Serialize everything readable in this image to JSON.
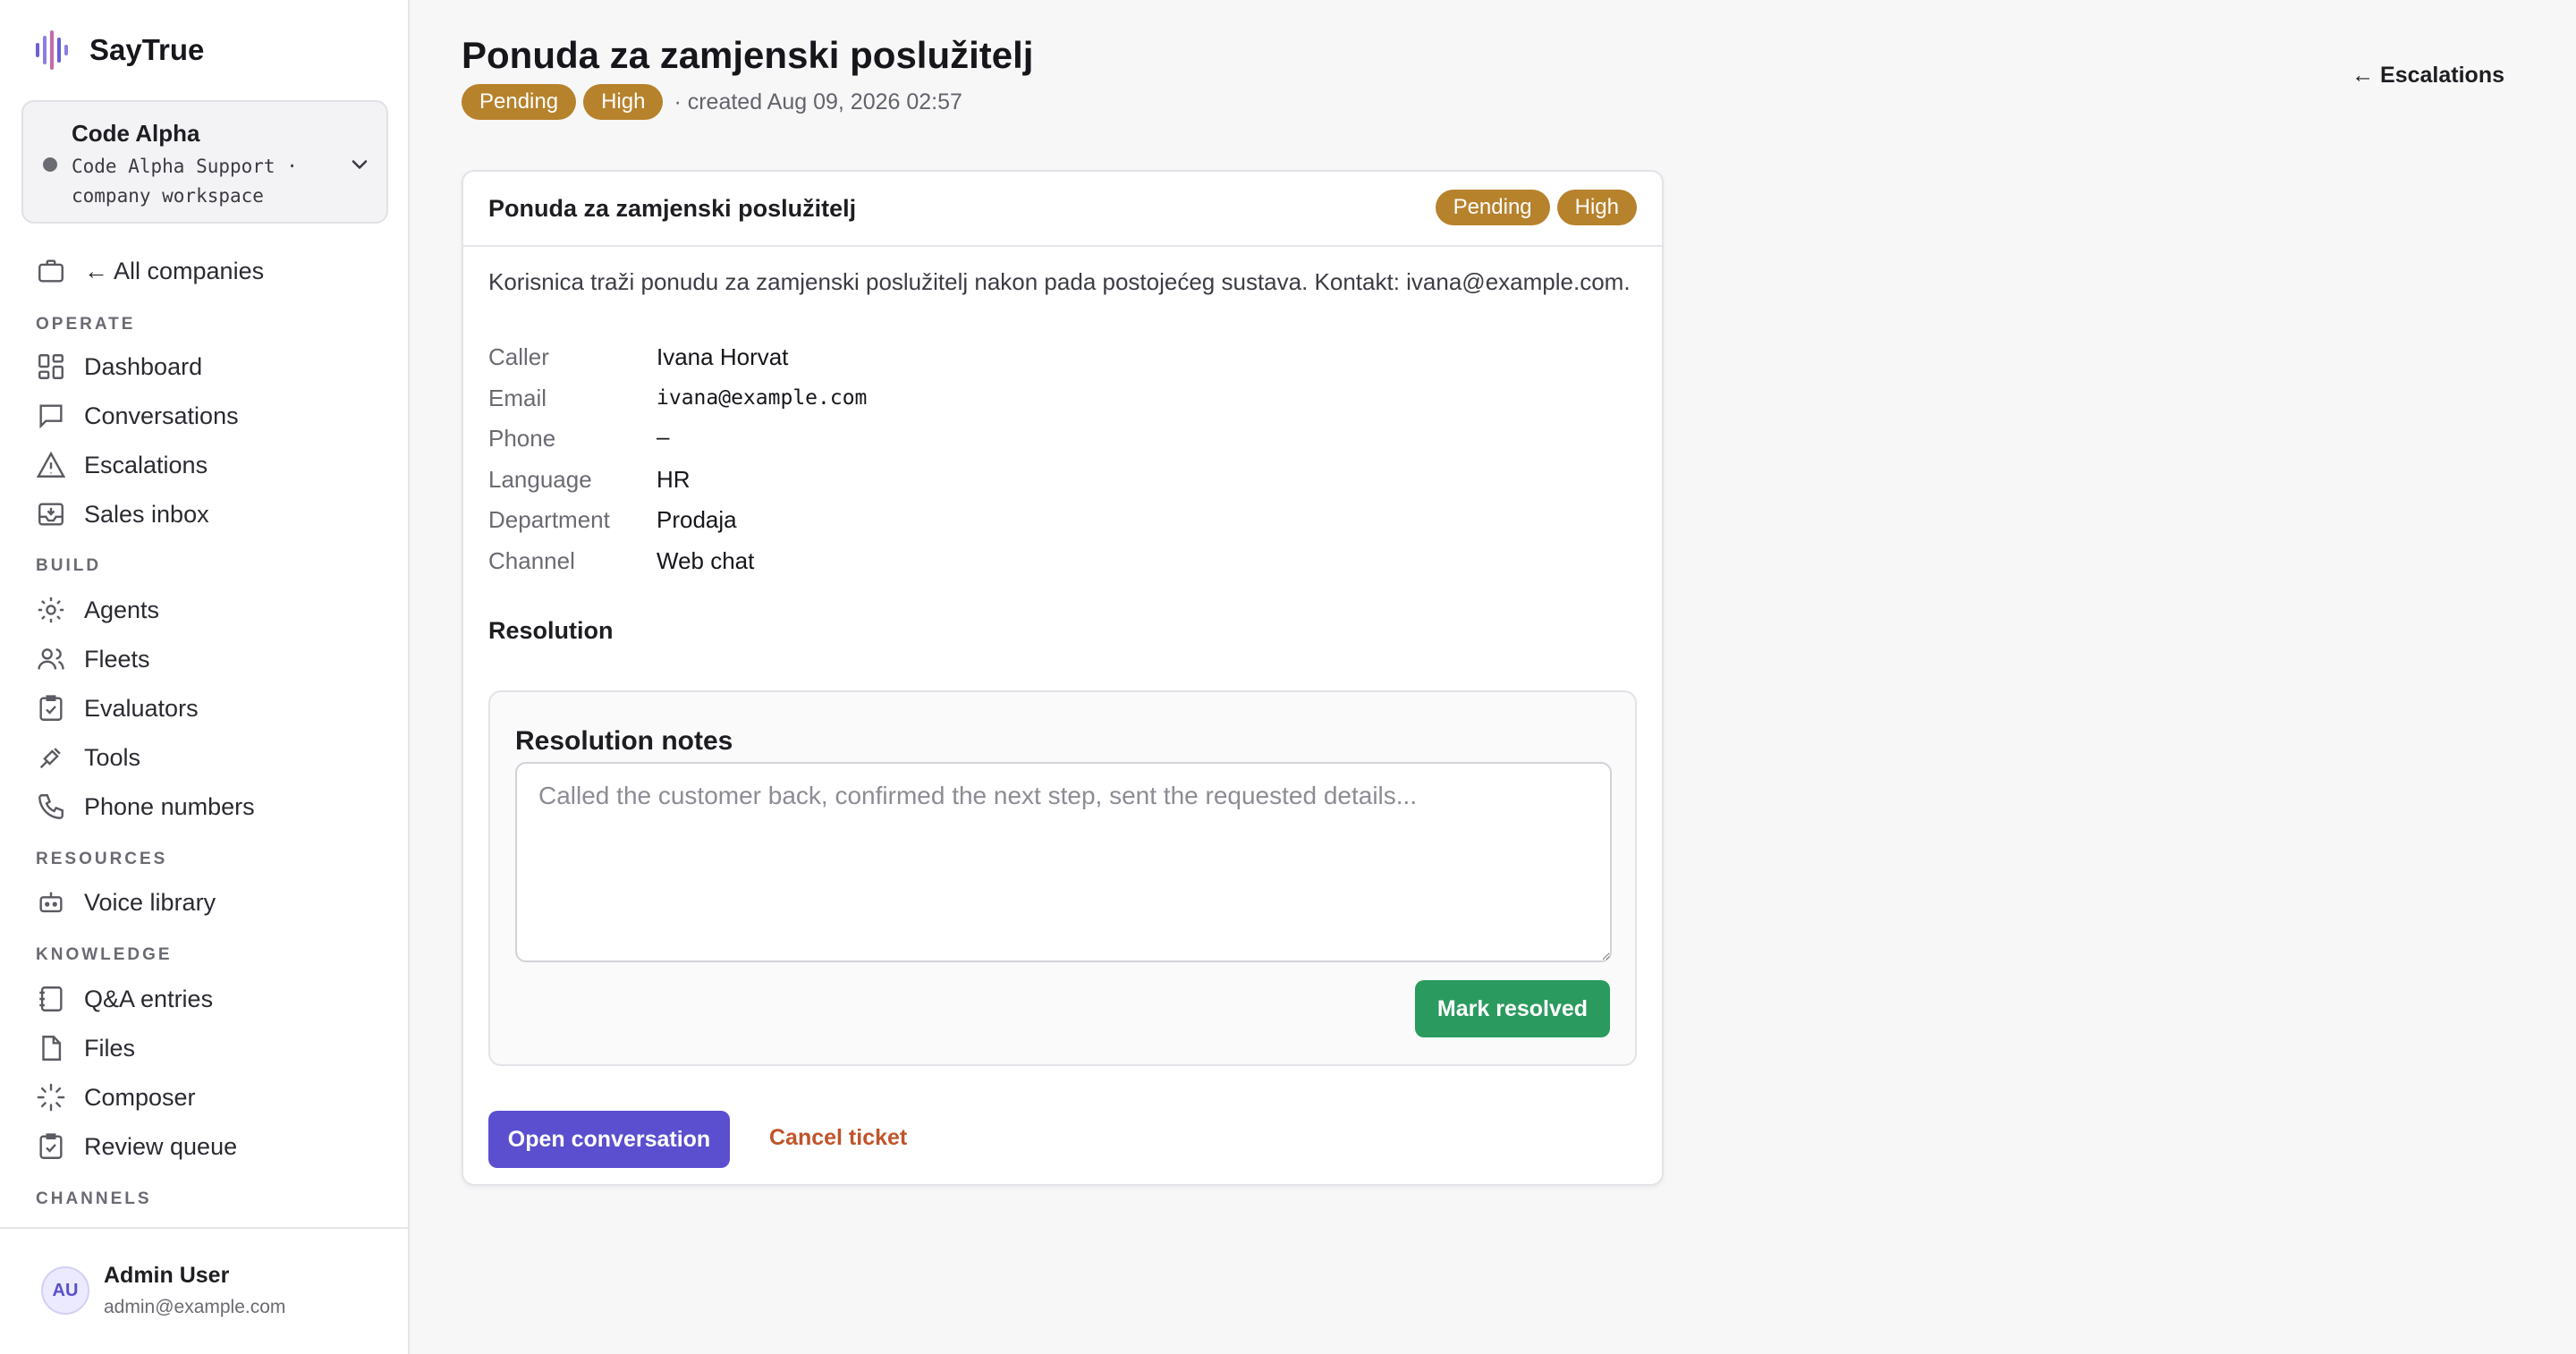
{
  "brand": {
    "name": "SayTrue",
    "accent": "#6b5fd6"
  },
  "workspace": {
    "name": "Code Alpha",
    "subtitle": "Code Alpha Support · company workspace"
  },
  "sidebar": {
    "back": "← All companies",
    "sections": {
      "operate": "OPERATE",
      "build": "BUILD",
      "resources": "RESOURCES",
      "knowledge": "KNOWLEDGE",
      "channels": "CHANNELS"
    },
    "items": {
      "dashboard": "Dashboard",
      "conversations": "Conversations",
      "escalations": "Escalations",
      "sales_inbox": "Sales inbox",
      "agents": "Agents",
      "fleets": "Fleets",
      "evaluators": "Evaluators",
      "tools": "Tools",
      "phone_numbers": "Phone numbers",
      "voice_library": "Voice library",
      "qa_entries": "Q&A entries",
      "files": "Files",
      "composer": "Composer",
      "review_queue": "Review queue"
    }
  },
  "user": {
    "initials": "AU",
    "name": "Admin User",
    "email": "admin@example.com"
  },
  "header": {
    "title": "Ponuda za zamjenski poslužitelj",
    "status": "Pending",
    "priority": "High",
    "created": "· created Aug 09, 2026 02:57",
    "back_link": "← Escalations"
  },
  "ticket": {
    "title": "Ponuda za zamjenski poslužitelj",
    "status": "Pending",
    "priority": "High",
    "description": "Korisnica traži ponudu za zamjenski poslužitelj nakon pada postojećeg sustava. Kontakt: ivana@example.com.",
    "fields": {
      "caller_label": "Caller",
      "caller": "Ivana Horvat",
      "email_label": "Email",
      "email": "ivana@example.com",
      "phone_label": "Phone",
      "phone": "–",
      "language_label": "Language",
      "language": "HR",
      "department_label": "Department",
      "department": "Prodaja",
      "channel_label": "Channel",
      "channel": "Web chat"
    },
    "resolution_heading": "Resolution",
    "resolution_notes_label": "Resolution notes",
    "resolution_placeholder": "Called the customer back, confirmed the next step, sent the requested details...",
    "mark_resolved": "Mark resolved",
    "open_conversation": "Open conversation",
    "cancel_ticket": "Cancel ticket"
  },
  "colors": {
    "badge": "#b7822c",
    "green_button": "#2b9a5e",
    "purple_button": "#5b4fcf",
    "cancel_link": "#c0542a"
  }
}
